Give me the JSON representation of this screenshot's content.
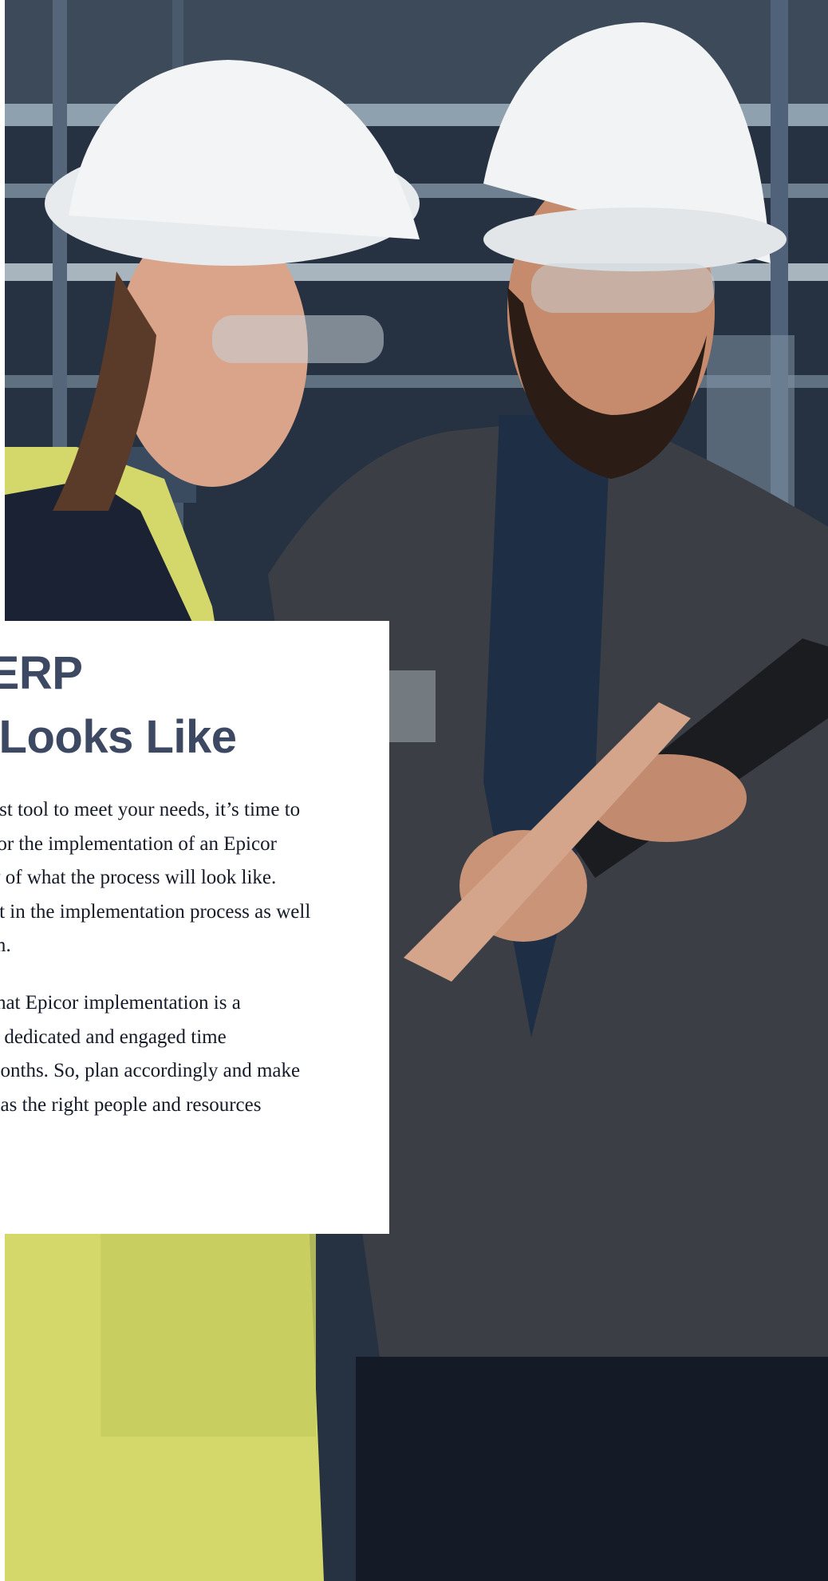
{
  "content": {
    "heading_lines": [
      "r ERP",
      "n Looks Like"
    ],
    "paragraph_1_lines": [
      "est tool to meet your needs, it’s time to",
      " for the implementation of an Epicor",
      "v of what the process will look like.",
      "ct in the implementation process as well",
      "m."
    ],
    "paragraph_2_lines": [
      "that Epicor implementation is a",
      " a dedicated and engaged time",
      "nonths. So, plan accordingly and make",
      " has the right people and resources"
    ]
  },
  "colors": {
    "heading": "#3d4863",
    "body_text": "#151a28",
    "card_background": "#ffffff",
    "vest_yellow": "#d7da6b",
    "hard_hat": "#eef0f1",
    "jacket": "#3b3f45"
  },
  "photo": {
    "subjects": [
      "woman-engineer",
      "man-engineer",
      "tablet"
    ]
  }
}
